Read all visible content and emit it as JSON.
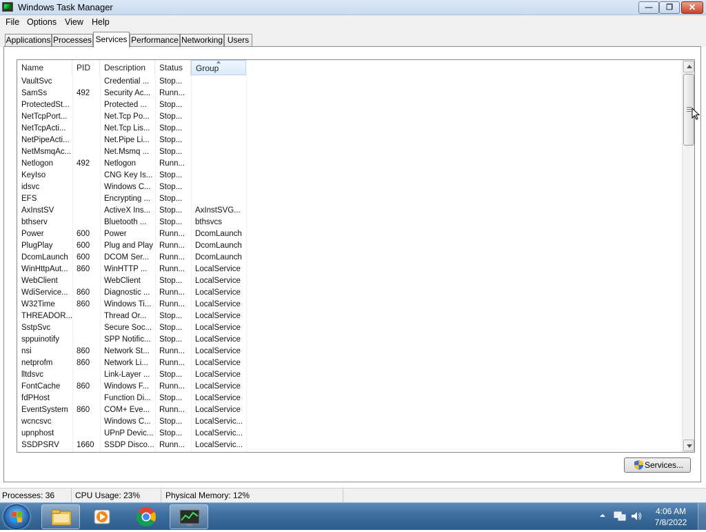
{
  "window": {
    "title": "Windows Task Manager",
    "buttons": {
      "minimize": "—",
      "maximize": "❐",
      "close": "✕"
    }
  },
  "menu": [
    "File",
    "Options",
    "View",
    "Help"
  ],
  "tabs": [
    {
      "label": "Applications",
      "active": false
    },
    {
      "label": "Processes",
      "active": false
    },
    {
      "label": "Services",
      "active": true
    },
    {
      "label": "Performance",
      "active": false
    },
    {
      "label": "Networking",
      "active": false
    },
    {
      "label": "Users",
      "active": false
    }
  ],
  "services_list": {
    "columns": [
      "Name",
      "PID",
      "Description",
      "Status",
      "Group"
    ],
    "sorted_column": "Group",
    "rows": [
      [
        "VaultSvc",
        "",
        "Credential ...",
        "Stop...",
        ""
      ],
      [
        "SamSs",
        "492",
        "Security Ac...",
        "Runn...",
        ""
      ],
      [
        "ProtectedSt...",
        "",
        "Protected ...",
        "Stop...",
        ""
      ],
      [
        "NetTcpPort...",
        "",
        "Net.Tcp Po...",
        "Stop...",
        ""
      ],
      [
        "NetTcpActi...",
        "",
        "Net.Tcp Lis...",
        "Stop...",
        ""
      ],
      [
        "NetPipeActi...",
        "",
        "Net.Pipe Li...",
        "Stop...",
        ""
      ],
      [
        "NetMsmqAc...",
        "",
        "Net.Msmq ...",
        "Stop...",
        ""
      ],
      [
        "Netlogon",
        "492",
        "Netlogon",
        "Runn...",
        ""
      ],
      [
        "KeyIso",
        "",
        "CNG Key Is...",
        "Stop...",
        ""
      ],
      [
        "idsvc",
        "",
        "Windows C...",
        "Stop...",
        ""
      ],
      [
        "EFS",
        "",
        "Encrypting ...",
        "Stop...",
        ""
      ],
      [
        "AxInstSV",
        "",
        "ActiveX Ins...",
        "Stop...",
        "AxInstSVG..."
      ],
      [
        "bthserv",
        "",
        "Bluetooth ...",
        "Stop...",
        "bthsvcs"
      ],
      [
        "Power",
        "600",
        "Power",
        "Runn...",
        "DcomLaunch"
      ],
      [
        "PlugPlay",
        "600",
        "Plug and Play",
        "Runn...",
        "DcomLaunch"
      ],
      [
        "DcomLaunch",
        "600",
        "DCOM Ser...",
        "Runn...",
        "DcomLaunch"
      ],
      [
        "WinHttpAut...",
        "860",
        "WinHTTP ...",
        "Runn...",
        "LocalService"
      ],
      [
        "WebClient",
        "",
        "WebClient",
        "Stop...",
        "LocalService"
      ],
      [
        "WdiService...",
        "860",
        "Diagnostic ...",
        "Runn...",
        "LocalService"
      ],
      [
        "W32Time",
        "860",
        "Windows Ti...",
        "Runn...",
        "LocalService"
      ],
      [
        "THREADOR...",
        "",
        "Thread Or...",
        "Stop...",
        "LocalService"
      ],
      [
        "SstpSvc",
        "",
        "Secure Soc...",
        "Stop...",
        "LocalService"
      ],
      [
        "sppuinotify",
        "",
        "SPP Notific...",
        "Stop...",
        "LocalService"
      ],
      [
        "nsi",
        "860",
        "Network St...",
        "Runn...",
        "LocalService"
      ],
      [
        "netprofm",
        "860",
        "Network Li...",
        "Runn...",
        "LocalService"
      ],
      [
        "lltdsvc",
        "",
        "Link-Layer ...",
        "Stop...",
        "LocalService"
      ],
      [
        "FontCache",
        "860",
        "Windows F...",
        "Runn...",
        "LocalService"
      ],
      [
        "fdPHost",
        "",
        "Function Di...",
        "Stop...",
        "LocalService"
      ],
      [
        "EventSystem",
        "860",
        "COM+ Eve...",
        "Runn...",
        "LocalService"
      ],
      [
        "wcncsvc",
        "",
        "Windows C...",
        "Stop...",
        "LocalServic..."
      ],
      [
        "upnphost",
        "",
        "UPnP Devic...",
        "Stop...",
        "LocalServic..."
      ],
      [
        "SSDPSRV",
        "1660",
        "SSDP Disco...",
        "Runn...",
        "LocalServic..."
      ]
    ]
  },
  "services_button": "Services...",
  "status": {
    "processes": "Processes: 36",
    "cpu": "CPU Usage: 23%",
    "memory": "Physical Memory: 12%"
  },
  "taskbar": {
    "pinned": [
      "file-explorer-icon",
      "media-player-icon",
      "chrome-icon",
      "task-manager-icon"
    ],
    "active_app": "task-manager-icon",
    "time": "4:06 AM",
    "date": "7/8/2022"
  },
  "colors": {
    "titlebar": "#c9dbef",
    "taskbar": "#3f6f9f",
    "sorted_header": "#dcecfb"
  }
}
